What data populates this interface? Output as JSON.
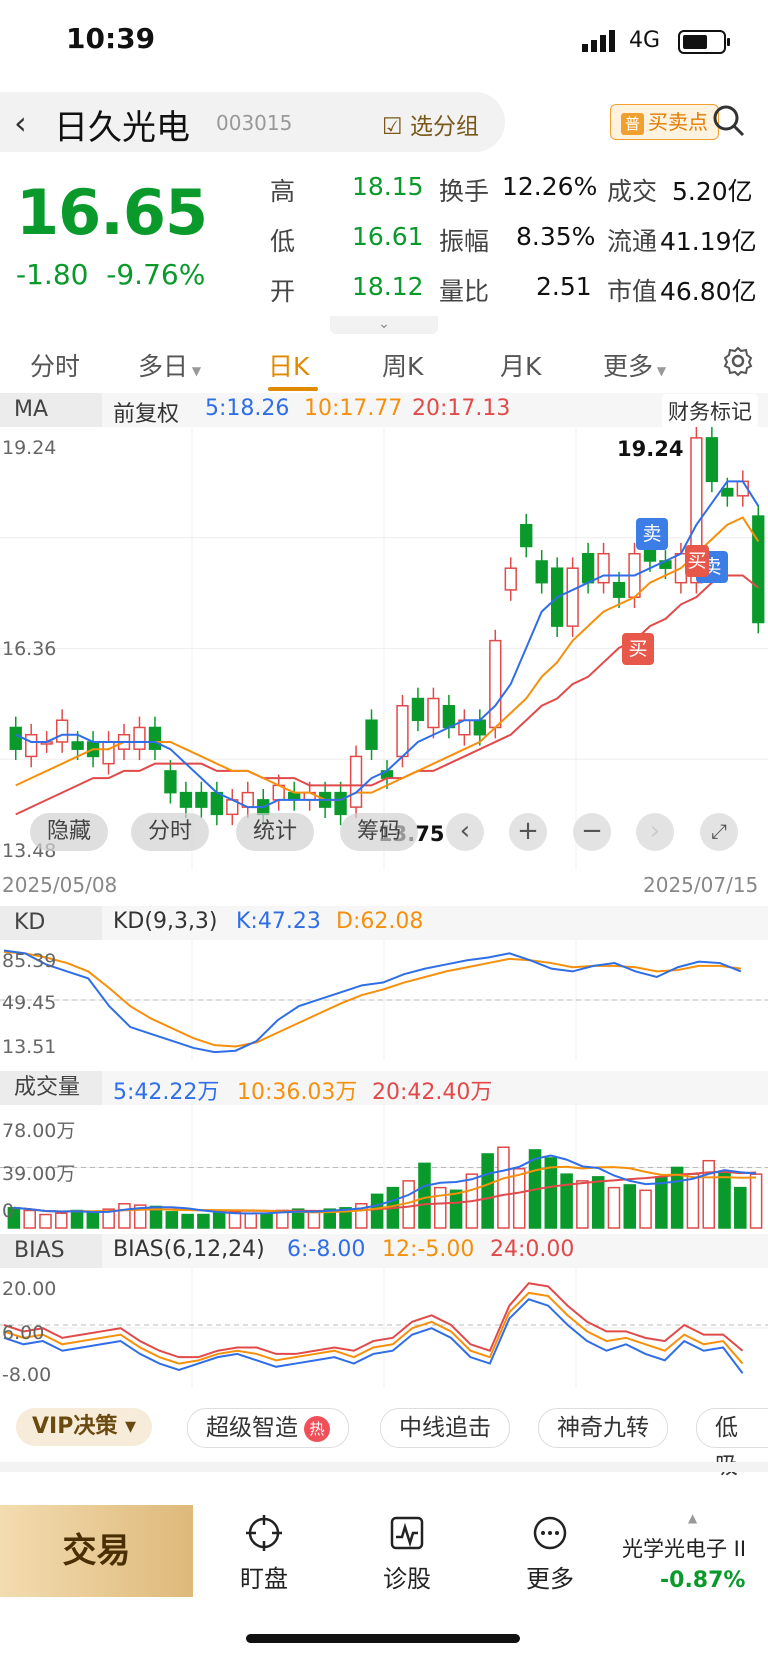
{
  "status": {
    "time": "10:39",
    "network": "4G"
  },
  "header": {
    "name": "日久光电",
    "code": "003015",
    "group_label": "选分组",
    "buy_point_prefix": "普",
    "buy_point_label": "买卖点"
  },
  "quote": {
    "price": "16.65",
    "change": "-1.80",
    "change_pct": "-9.76%",
    "high_label": "高",
    "high": "18.15",
    "turnover_label": "换手",
    "turnover": "12.26%",
    "amount_label": "成交",
    "amount": "5.20亿",
    "low_label": "低",
    "low": "16.61",
    "amplitude_label": "振幅",
    "amplitude": "8.35%",
    "float_label": "流通",
    "float_cap": "41.19亿",
    "open_label": "开",
    "open": "18.12",
    "vol_ratio_label": "量比",
    "vol_ratio": "2.51",
    "mcap_label": "市值",
    "mcap": "46.80亿"
  },
  "tabs": {
    "t1": "分时",
    "t2": "多日",
    "t3": "日K",
    "t4": "周K",
    "t5": "月K",
    "t6": "更多",
    "active": "日K"
  },
  "ma_bar": {
    "label": "MA",
    "adj": "前复权",
    "ma5": "5:18.26",
    "ma10": "10:17.77",
    "ma20": "20:17.13",
    "finance": "财务标记"
  },
  "kchart": {
    "y_top": "19.24",
    "y_mid": "16.36",
    "y_bot": "13.48",
    "high_label": "19.24",
    "low_label": "13.75",
    "date_start": "2025/05/08",
    "date_end": "2025/07/15",
    "sell": "卖",
    "buy": "买",
    "overlay": {
      "hide": "隐藏",
      "fenshi": "分时",
      "stats": "统计",
      "chips": "筹码"
    }
  },
  "kd_bar": {
    "label": "KD",
    "params": "KD(9,3,3)",
    "k": "K:47.23",
    "d": "D:62.08",
    "y_top": "85.39",
    "y_mid": "49.45",
    "y_bot": "13.51"
  },
  "vol_bar": {
    "label": "成交量",
    "ma5": "5:42.22万",
    "ma10": "10:36.03万",
    "ma20": "20:42.40万",
    "y_top": "78.00万",
    "y_mid": "39.00万",
    "y_bot": "0"
  },
  "bias_bar": {
    "label": "BIAS",
    "params": "BIAS(6,12,24)",
    "b6": "6:-8.00",
    "b12": "12:-5.00",
    "b24": "24:0.00",
    "y_top": "20.00",
    "y_mid": "6.00",
    "y_bot": "-8.00"
  },
  "strategy": {
    "vip": "VIP决策",
    "c1": "超级智造",
    "hot": "热",
    "c2": "中线追击",
    "c3": "神奇九转",
    "c4": "低吸"
  },
  "bottom": {
    "trade": "交易",
    "watch": "盯盘",
    "diagnose": "诊股",
    "more": "更多",
    "sector": "光学光电子 II",
    "sector_chg": "-0.87%"
  },
  "colors": {
    "down": "#0a9a2c",
    "up": "#e04a4a",
    "accent": "#e08a00",
    "ma5": "#2f6ee6",
    "ma10": "#f5900c",
    "ma20": "#e04a4a"
  },
  "chart_data": {
    "type": "candlestick",
    "title": "",
    "ylim": [
      13.48,
      19.24
    ],
    "candles": [
      {
        "o": 15.2,
        "c": 14.9
      },
      {
        "o": 14.8,
        "c": 15.1
      },
      {
        "o": 15.0,
        "c": 15.0
      },
      {
        "o": 15.0,
        "c": 15.3
      },
      {
        "o": 15.0,
        "c": 14.9
      },
      {
        "o": 15.0,
        "c": 14.8
      },
      {
        "o": 14.7,
        "c": 15.0
      },
      {
        "o": 14.9,
        "c": 15.1
      },
      {
        "o": 14.9,
        "c": 15.2
      },
      {
        "o": 15.2,
        "c": 14.9
      },
      {
        "o": 14.6,
        "c": 14.3
      },
      {
        "o": 14.3,
        "c": 14.1
      },
      {
        "o": 14.3,
        "c": 14.1
      },
      {
        "o": 14.3,
        "c": 14.0
      },
      {
        "o": 14.0,
        "c": 14.2
      },
      {
        "o": 14.1,
        "c": 14.3
      },
      {
        "o": 14.2,
        "c": 14.0
      },
      {
        "o": 14.2,
        "c": 14.4
      },
      {
        "o": 14.3,
        "c": 14.2
      },
      {
        "o": 14.2,
        "c": 14.3
      },
      {
        "o": 14.3,
        "c": 14.1
      },
      {
        "o": 14.3,
        "c": 14.0
      },
      {
        "o": 14.1,
        "c": 14.8
      },
      {
        "o": 15.3,
        "c": 14.9
      },
      {
        "o": 14.6,
        "c": 14.5
      },
      {
        "o": 14.8,
        "c": 15.5
      },
      {
        "o": 15.6,
        "c": 15.3
      },
      {
        "o": 15.2,
        "c": 15.6
      },
      {
        "o": 15.5,
        "c": 15.2
      },
      {
        "o": 15.1,
        "c": 15.3
      },
      {
        "o": 15.3,
        "c": 15.1
      },
      {
        "o": 15.2,
        "c": 16.4
      },
      {
        "o": 17.1,
        "c": 17.4
      },
      {
        "o": 18.0,
        "c": 17.7
      },
      {
        "o": 17.5,
        "c": 17.2
      },
      {
        "o": 17.4,
        "c": 16.6
      },
      {
        "o": 16.6,
        "c": 17.4
      },
      {
        "o": 17.6,
        "c": 17.2
      },
      {
        "o": 17.2,
        "c": 17.6
      },
      {
        "o": 17.2,
        "c": 17.0
      },
      {
        "o": 17.0,
        "c": 17.6
      },
      {
        "o": 17.8,
        "c": 17.5
      },
      {
        "o": 17.5,
        "c": 17.4
      },
      {
        "o": 17.2,
        "c": 17.6
      },
      {
        "o": 17.2,
        "c": 19.2
      },
      {
        "o": 19.2,
        "c": 18.6
      },
      {
        "o": 18.5,
        "c": 18.4
      },
      {
        "o": 18.4,
        "c": 18.6
      },
      {
        "o": 18.12,
        "c": 16.65
      }
    ],
    "ma5": [
      15.1,
      15.0,
      15.0,
      15.1,
      15.1,
      15.0,
      15.0,
      15.0,
      15.0,
      15.0,
      14.9,
      14.7,
      14.5,
      14.3,
      14.2,
      14.1,
      14.1,
      14.2,
      14.2,
      14.2,
      14.2,
      14.2,
      14.3,
      14.5,
      14.6,
      14.8,
      15.0,
      15.1,
      15.2,
      15.3,
      15.3,
      15.5,
      15.8,
      16.3,
      16.8,
      17.0,
      17.1,
      17.2,
      17.3,
      17.3,
      17.3,
      17.4,
      17.5,
      17.6,
      18.0,
      18.3,
      18.6,
      18.6,
      18.26
    ],
    "ma10": [
      14.4,
      14.5,
      14.6,
      14.7,
      14.8,
      14.9,
      14.9,
      15.0,
      15.0,
      15.0,
      15.0,
      14.9,
      14.8,
      14.7,
      14.6,
      14.6,
      14.5,
      14.4,
      14.3,
      14.3,
      14.2,
      14.2,
      14.3,
      14.3,
      14.4,
      14.5,
      14.6,
      14.7,
      14.8,
      14.9,
      15.0,
      15.2,
      15.4,
      15.6,
      15.9,
      16.1,
      16.4,
      16.6,
      16.8,
      16.9,
      17.0,
      17.2,
      17.3,
      17.4,
      17.6,
      17.8,
      18.0,
      18.1,
      17.77
    ],
    "ma20": [
      14.0,
      14.1,
      14.2,
      14.3,
      14.4,
      14.5,
      14.5,
      14.6,
      14.6,
      14.7,
      14.7,
      14.7,
      14.7,
      14.6,
      14.6,
      14.6,
      14.5,
      14.5,
      14.5,
      14.4,
      14.4,
      14.4,
      14.4,
      14.4,
      14.5,
      14.5,
      14.6,
      14.6,
      14.7,
      14.8,
      14.9,
      15.0,
      15.1,
      15.3,
      15.5,
      15.6,
      15.8,
      15.9,
      16.1,
      16.3,
      16.4,
      16.6,
      16.7,
      16.9,
      17.0,
      17.2,
      17.3,
      17.3,
      17.13
    ],
    "kd_k": [
      85,
      83,
      75,
      70,
      65,
      45,
      30,
      25,
      20,
      15,
      12,
      13,
      20,
      35,
      45,
      50,
      55,
      60,
      62,
      68,
      72,
      75,
      78,
      80,
      83,
      78,
      72,
      70,
      74,
      76,
      70,
      66,
      73,
      77,
      76,
      70
    ],
    "kd_d": [
      84,
      83,
      80,
      76,
      70,
      58,
      45,
      36,
      29,
      22,
      17,
      16,
      19,
      26,
      33,
      40,
      47,
      53,
      57,
      62,
      66,
      70,
      73,
      76,
      79,
      78,
      76,
      73,
      74,
      74,
      73,
      70,
      71,
      74,
      74,
      72
    ],
    "volume": [
      15,
      13,
      10,
      11,
      13,
      12,
      14,
      18,
      17,
      16,
      12,
      10,
      10,
      11,
      12,
      11,
      11,
      13,
      14,
      12,
      14,
      15,
      18,
      25,
      30,
      35,
      48,
      30,
      28,
      40,
      55,
      60,
      44,
      58,
      52,
      40,
      35,
      38,
      30,
      32,
      28,
      38,
      45,
      40,
      50,
      42,
      30,
      40
    ],
    "bias6": [
      2,
      0,
      1,
      -2,
      -1,
      0,
      1,
      -3,
      -6,
      -8,
      -6,
      -4,
      -3,
      -5,
      -7,
      -6,
      -5,
      -4,
      -6,
      -3,
      -2,
      3,
      5,
      2,
      -4,
      -6,
      8,
      14,
      12,
      6,
      1,
      -2,
      0,
      -3,
      -5,
      1,
      -2,
      -1,
      -9
    ],
    "bias12": [
      4,
      2,
      3,
      0,
      1,
      2,
      3,
      -1,
      -4,
      -6,
      -5,
      -3,
      -2,
      -3,
      -5,
      -4,
      -3,
      -2,
      -4,
      -1,
      0,
      5,
      7,
      4,
      -2,
      -4,
      10,
      16,
      15,
      9,
      4,
      1,
      2,
      0,
      -2,
      3,
      0,
      1,
      -6
    ],
    "bias24": [
      6,
      4,
      5,
      2,
      3,
      4,
      5,
      1,
      -2,
      -4,
      -4,
      -2,
      -1,
      -1,
      -3,
      -3,
      -2,
      -1,
      -2,
      1,
      2,
      7,
      9,
      6,
      0,
      -2,
      12,
      19,
      18,
      12,
      7,
      4,
      4,
      2,
      1,
      6,
      3,
      3,
      -2
    ]
  }
}
